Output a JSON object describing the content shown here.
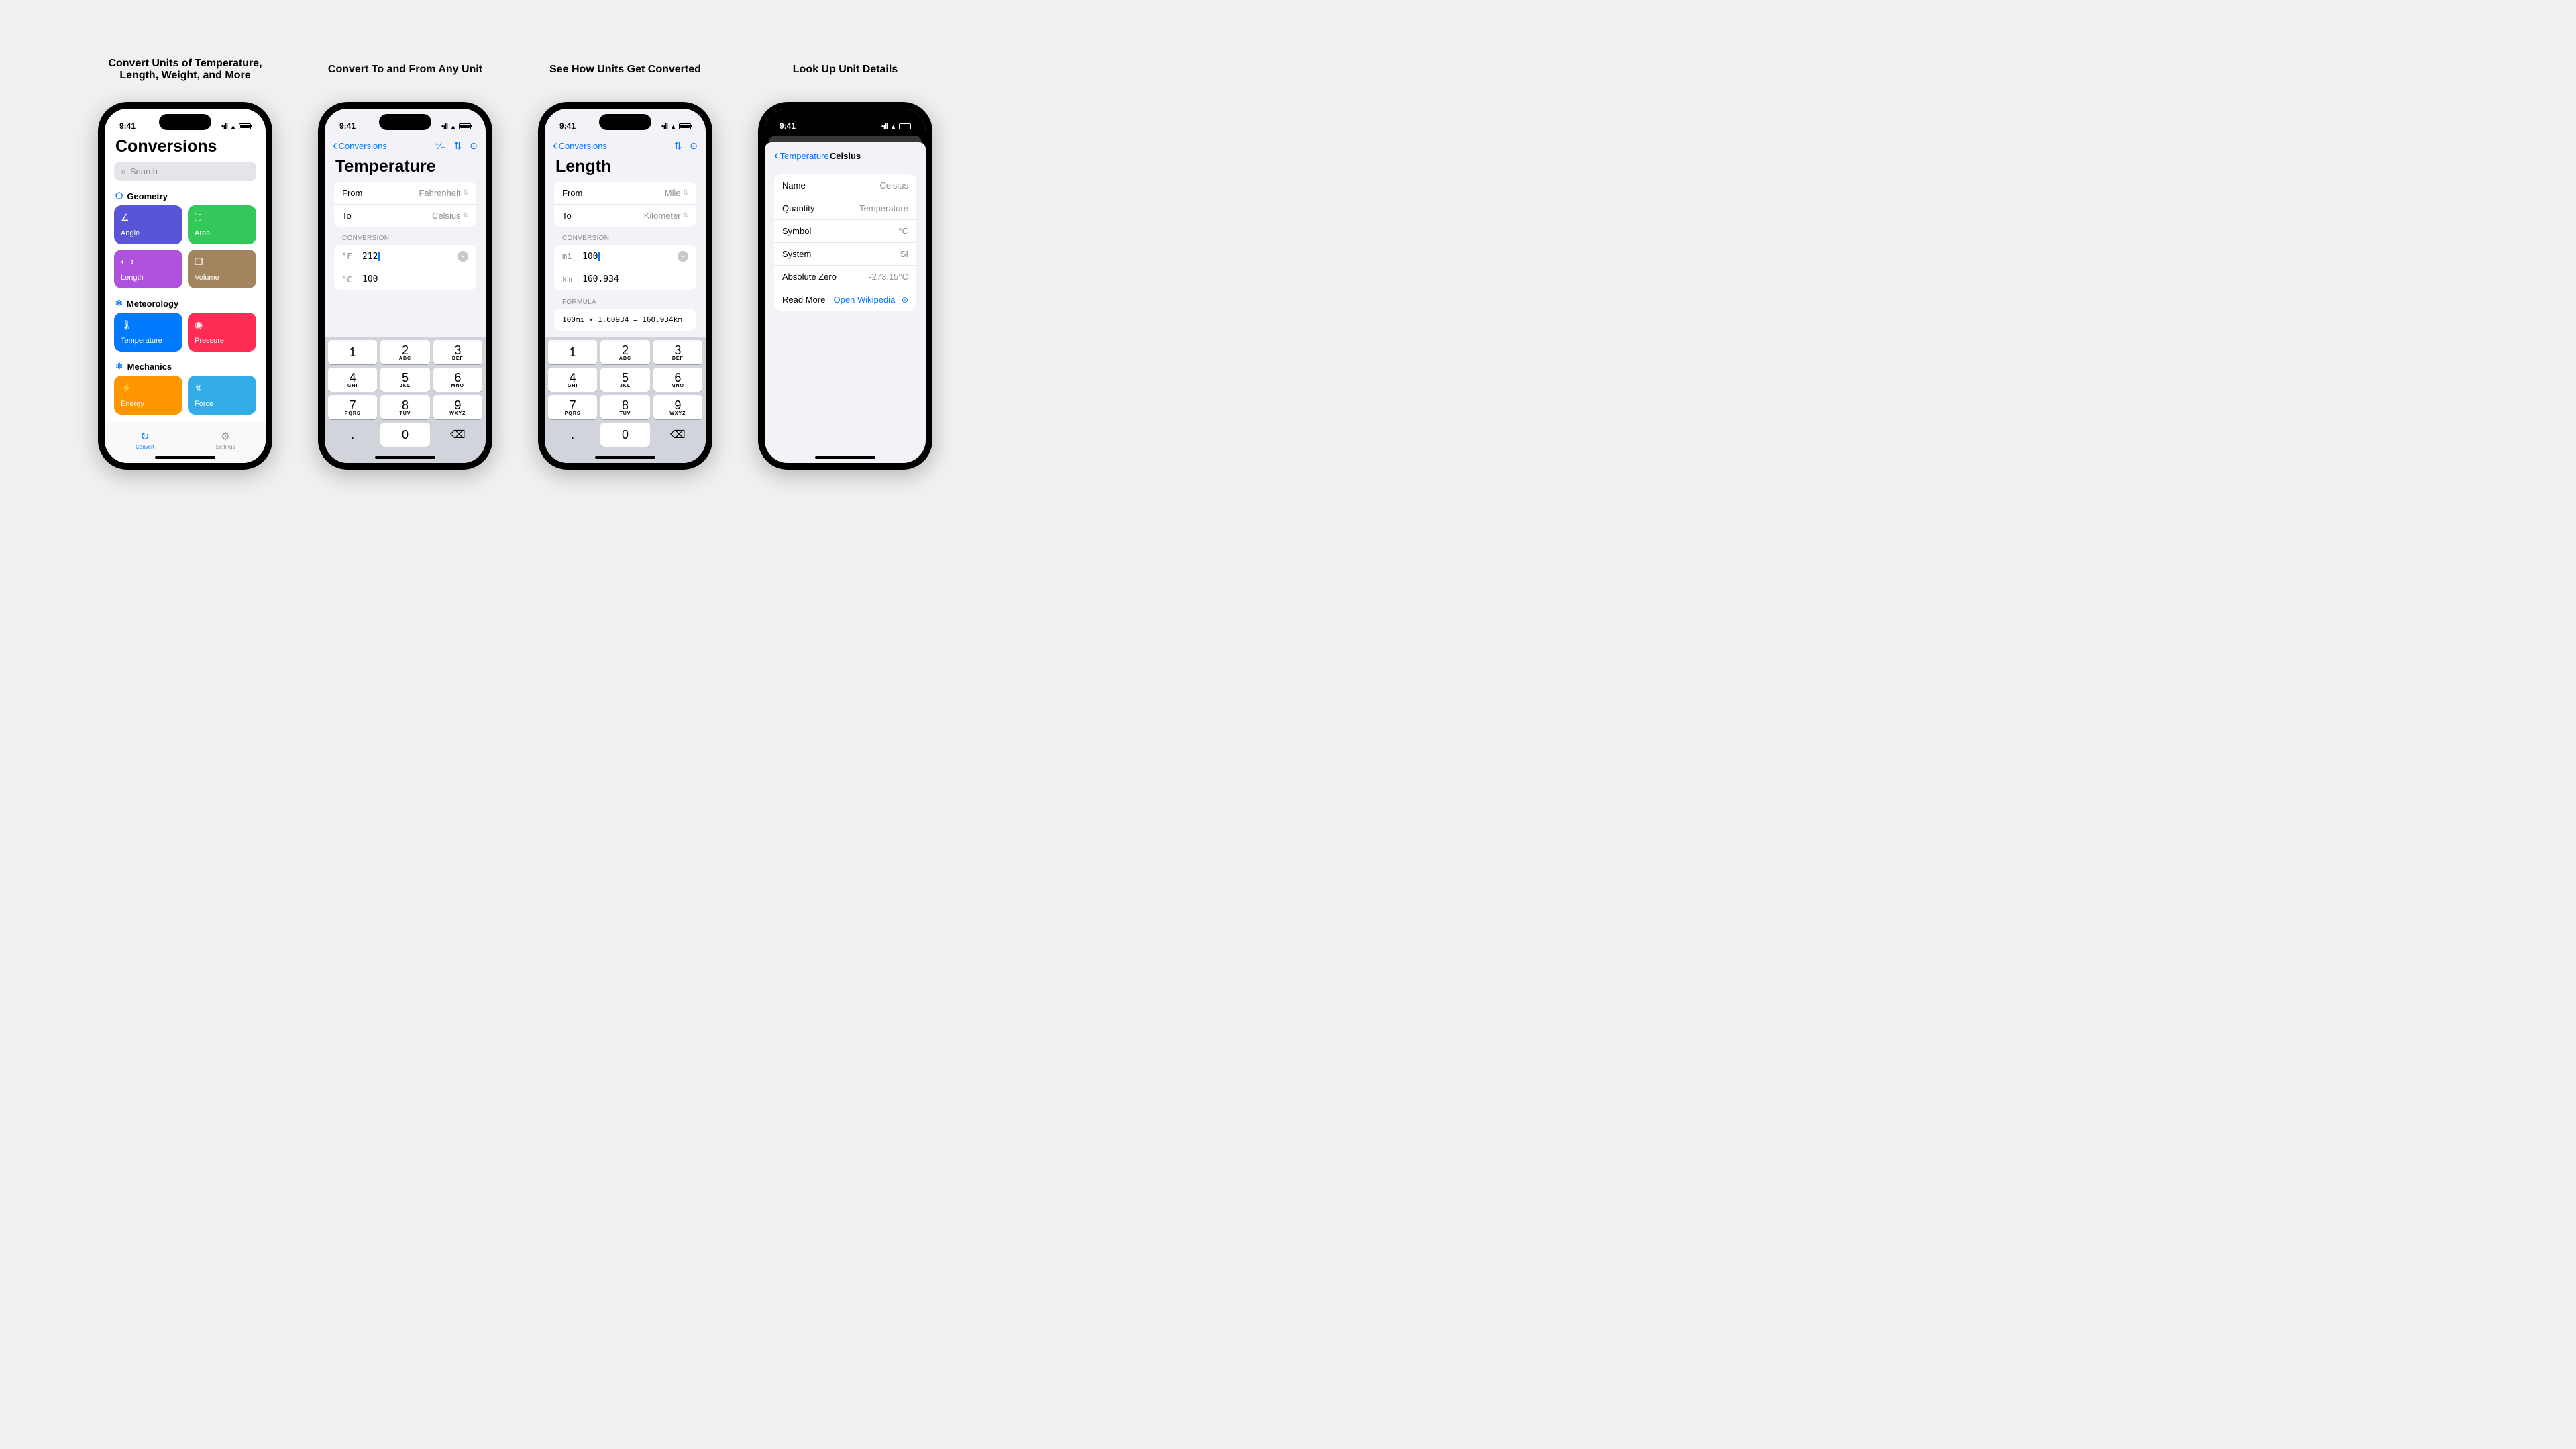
{
  "status": {
    "time": "9:41"
  },
  "captions": [
    "Convert Units of Temperature, Length, Weight, and More",
    "Convert To and From Any Unit",
    "See How Units Get Converted",
    "Look Up Unit Details"
  ],
  "screen1": {
    "title": "Conversions",
    "search_placeholder": "Search",
    "sections": [
      {
        "name": "Geometry",
        "icon": "⬠",
        "tiles": [
          {
            "label": "Angle",
            "icon": "∠",
            "color": "#5856d6"
          },
          {
            "label": "Area",
            "icon": "⛶",
            "color": "#34c759"
          },
          {
            "label": "Length",
            "icon": "⟷",
            "color": "#af52de"
          },
          {
            "label": "Volume",
            "icon": "❒",
            "color": "#a2845e"
          }
        ]
      },
      {
        "name": "Meteorology",
        "icon": "❄",
        "tiles": [
          {
            "label": "Temperature",
            "icon": "🌡",
            "color": "#007aff"
          },
          {
            "label": "Pressure",
            "icon": "◉",
            "color": "#ff2d55"
          }
        ]
      },
      {
        "name": "Mechanics",
        "icon": "⚛",
        "tiles": [
          {
            "label": "Energy",
            "icon": "⚡",
            "color": "#ff9500"
          },
          {
            "label": "Force",
            "icon": "↯",
            "color": "#32ade6"
          }
        ]
      }
    ],
    "tabs": {
      "convert": "Convert",
      "settings": "Settings"
    }
  },
  "screen2": {
    "back": "Conversions",
    "title": "Temperature",
    "from_label": "From",
    "from_value": "Fahrenheit",
    "to_label": "To",
    "to_value": "Celsius",
    "conversion_label": "CONVERSION",
    "input_unit": "°F",
    "input_value": "212",
    "output_unit": "°C",
    "output_value": "100"
  },
  "screen3": {
    "back": "Conversions",
    "title": "Length",
    "from_label": "From",
    "from_value": "Mile",
    "to_label": "To",
    "to_value": "Kilometer",
    "conversion_label": "CONVERSION",
    "input_unit": "mi",
    "input_value": "100",
    "output_unit": "km",
    "output_value": "160.934",
    "formula_label": "FORMULA",
    "formula": "100mi × 1.60934 = 160.934km"
  },
  "screen4": {
    "back": "Temperature",
    "title": "Celsius",
    "rows": [
      {
        "label": "Name",
        "value": "Celsius"
      },
      {
        "label": "Quantity",
        "value": "Temperature"
      },
      {
        "label": "Symbol",
        "value": "°C"
      },
      {
        "label": "System",
        "value": "SI"
      },
      {
        "label": "Absolute Zero",
        "value": "-273.15°C"
      }
    ],
    "readmore_label": "Read More",
    "readmore_value": "Open Wikipedia"
  },
  "keypad": [
    {
      "n": "1",
      "s": ""
    },
    {
      "n": "2",
      "s": "ABC"
    },
    {
      "n": "3",
      "s": "DEF"
    },
    {
      "n": "4",
      "s": "GHI"
    },
    {
      "n": "5",
      "s": "JKL"
    },
    {
      "n": "6",
      "s": "MNO"
    },
    {
      "n": "7",
      "s": "PQRS"
    },
    {
      "n": "8",
      "s": "TUV"
    },
    {
      "n": "9",
      "s": "WXYZ"
    },
    {
      "n": ".",
      "s": "",
      "fn": true
    },
    {
      "n": "0",
      "s": ""
    },
    {
      "n": "⌫",
      "s": "",
      "del": true
    }
  ]
}
